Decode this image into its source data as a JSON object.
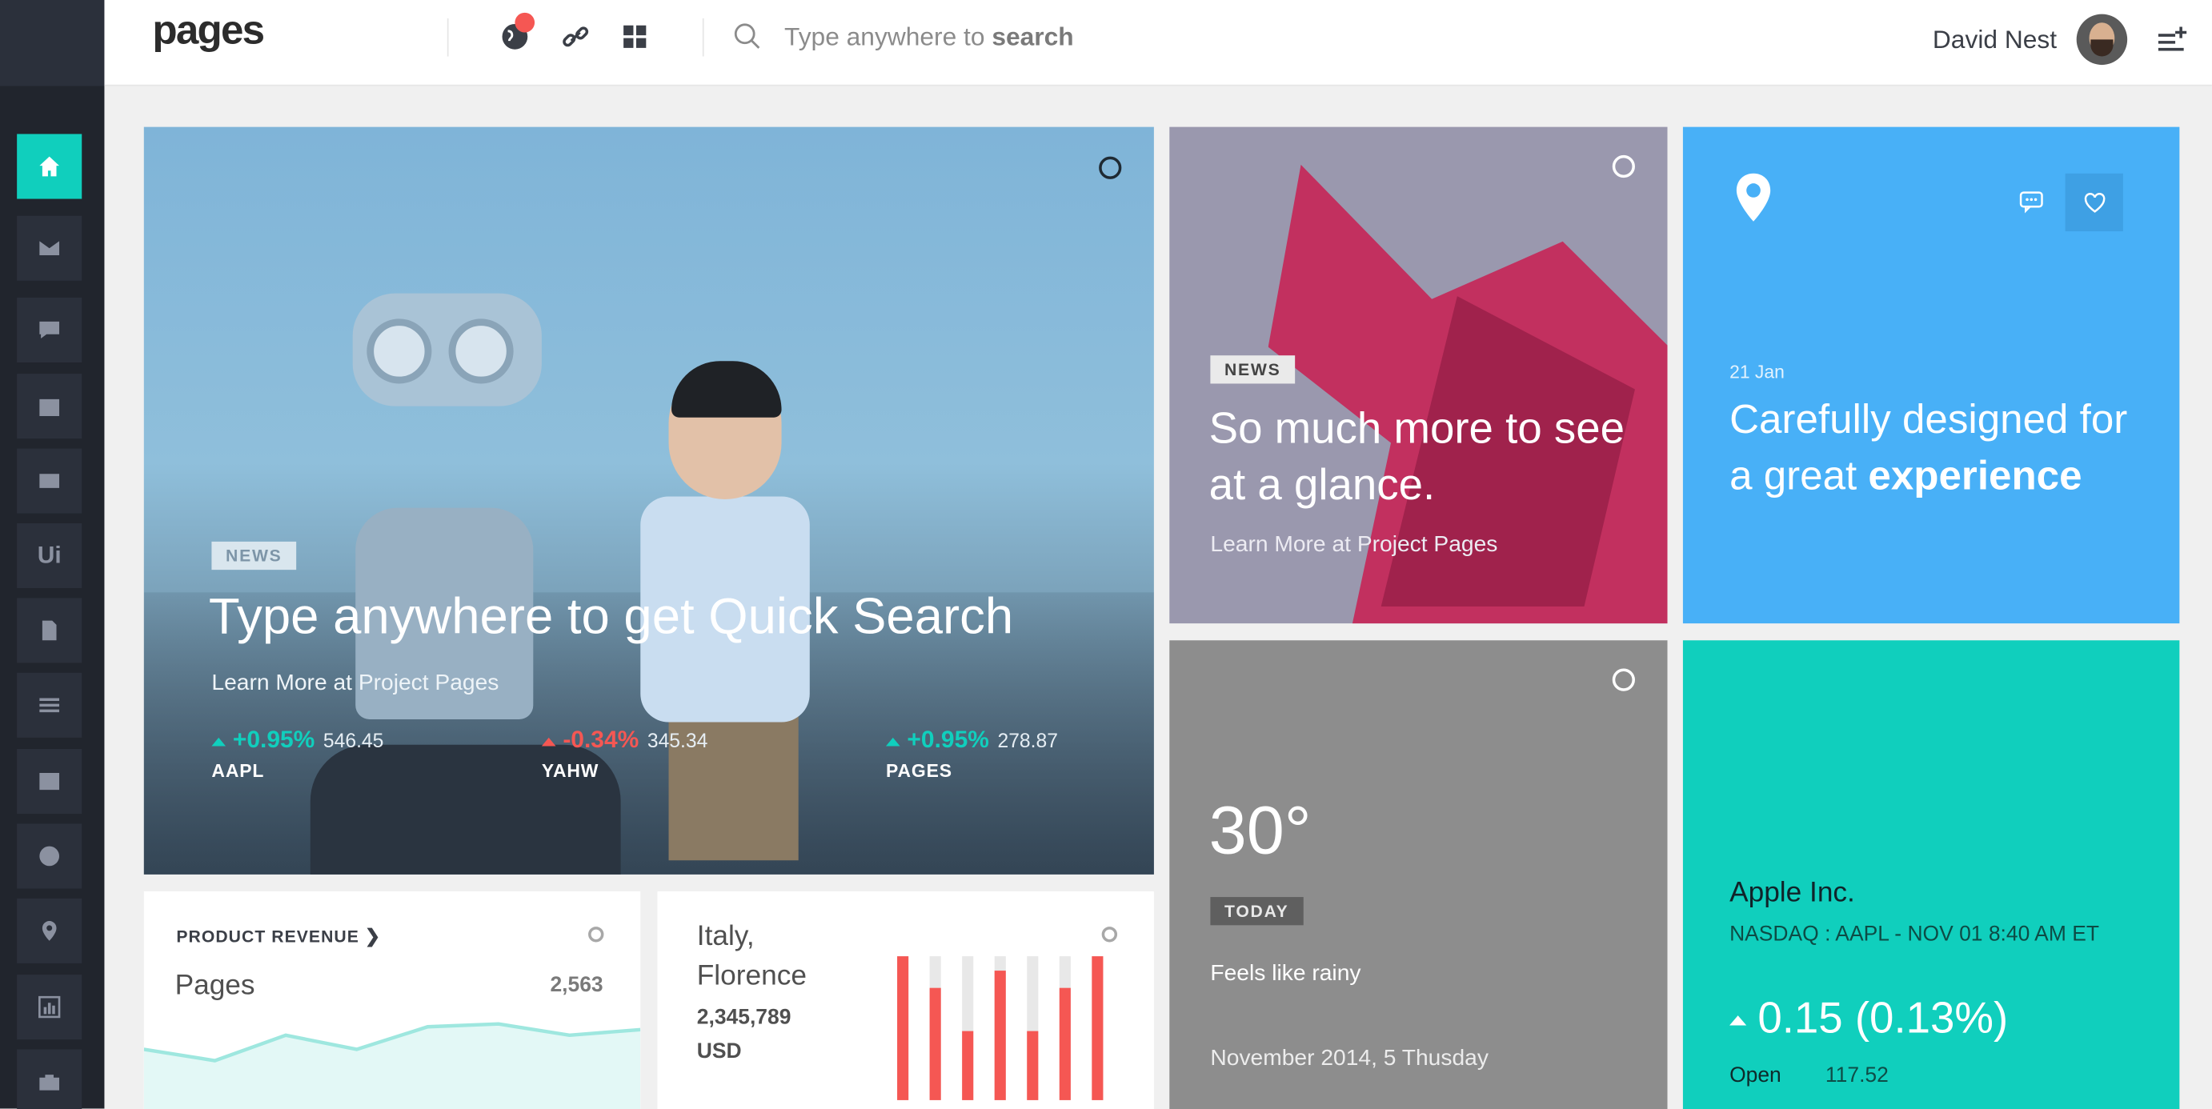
{
  "header": {
    "logo": "pages",
    "search_placeholder_prefix": "Type anywhere to ",
    "search_placeholder_bold": "search",
    "user_name": "David Nest"
  },
  "sidebar": {
    "items": [
      {
        "name": "home",
        "icon": "home-icon",
        "active": true
      },
      {
        "name": "email",
        "icon": "envelope-icon"
      },
      {
        "name": "social",
        "icon": "chat-icon"
      },
      {
        "name": "calendar",
        "icon": "calendar-icon"
      },
      {
        "name": "builder",
        "icon": "layout-icon"
      },
      {
        "name": "ui",
        "icon": "ui-icon",
        "label": "Ui"
      },
      {
        "name": "forms",
        "icon": "file-icon"
      },
      {
        "name": "lists",
        "icon": "list-icon"
      },
      {
        "name": "tables",
        "icon": "table-icon"
      },
      {
        "name": "maps",
        "icon": "globe-icon"
      },
      {
        "name": "location",
        "icon": "pin-icon"
      },
      {
        "name": "charts",
        "icon": "bar-chart-icon"
      },
      {
        "name": "extra",
        "icon": "briefcase-icon"
      }
    ]
  },
  "hero": {
    "badge": "NEWS",
    "title": "Type anywhere to get Quick Search",
    "subtitle": "Learn More at Project Pages",
    "stocks": [
      {
        "change": "+0.95%",
        "direction": "up",
        "value": "546.45",
        "ticker": "AAPL"
      },
      {
        "change": "-0.34%",
        "direction": "down",
        "value": "345.34",
        "ticker": "YAHW"
      },
      {
        "change": "+0.95%",
        "direction": "up",
        "value": "278.87",
        "ticker": "PAGES"
      }
    ]
  },
  "news2": {
    "badge": "NEWS",
    "title": "So much more to see at a glance.",
    "subtitle": "Learn More at Project Pages"
  },
  "blue_tile": {
    "date": "21 Jan",
    "title_prefix": "Carefully designed for a great ",
    "title_bold": "experience"
  },
  "weather": {
    "temperature": "30°",
    "badge": "TODAY",
    "feels": "Feels like rainy",
    "date": "November 2014, 5 Thusday"
  },
  "apple": {
    "name": "Apple Inc.",
    "market": "NASDAQ : AAPL - NOV 01 8:40 AM ET",
    "change": "0.15 (0.13%)",
    "open_label": "Open",
    "open_value": "117.52"
  },
  "revenue": {
    "heading": "PRODUCT REVENUE",
    "label": "Pages",
    "value": "2,563"
  },
  "italy": {
    "city": "Italy, Florence",
    "amount": "2,345,789",
    "currency": "USD"
  },
  "colors": {
    "accent": "#10cfbd",
    "danger": "#f55753",
    "blue": "#48b0f7",
    "sidebar": "#21252d"
  },
  "chart_data": [
    {
      "type": "area",
      "x": [
        0,
        1,
        2,
        3,
        4,
        5,
        6,
        7
      ],
      "values": [
        48,
        40,
        58,
        48,
        64,
        66,
        58,
        62
      ],
      "ylim": [
        0,
        100
      ]
    },
    {
      "type": "bar",
      "categories": [
        "1",
        "2",
        "3",
        "4",
        "5",
        "6",
        "7"
      ],
      "values": [
        100,
        78,
        48,
        90,
        48,
        78,
        100
      ],
      "ylim": [
        0,
        100
      ]
    }
  ]
}
